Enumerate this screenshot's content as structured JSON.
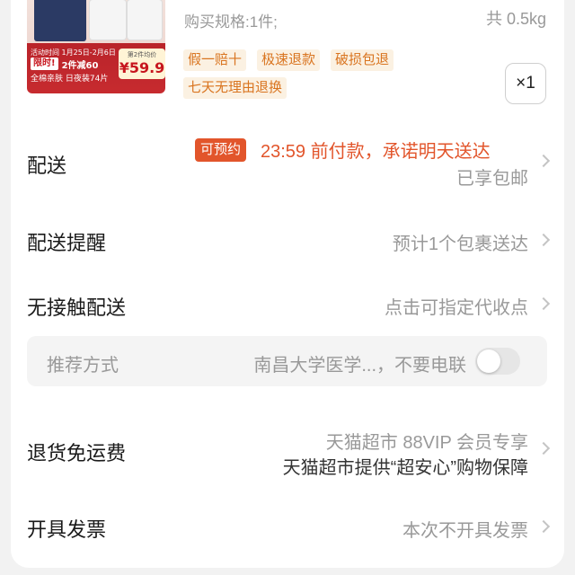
{
  "product": {
    "thumb": {
      "top_text": "活动时间 1月25日-2月6日",
      "promo_chip": "限时!",
      "promo_text": "2件减60",
      "bottom_text": "全棉亲肤 日夜装74片",
      "price_small": "第2件均价",
      "price": "¥59.9"
    },
    "spec": "购买规格:1件;",
    "weight": "共 0.5kg",
    "tags": [
      "假一赔十",
      "极速退款",
      "破损包退",
      "七天无理由退换"
    ],
    "quantity": "×1"
  },
  "delivery": {
    "label": "配送",
    "badge": "可预约",
    "promise": "23:59 前付款，承诺明天送达",
    "shipping": "已享包邮"
  },
  "delivery_reminder": {
    "label": "配送提醒",
    "value": "预计1个包裹送达"
  },
  "contactless": {
    "label": "无接触配送",
    "value": "点击可指定代收点"
  },
  "recommend": {
    "label": "推荐方式",
    "value": "南昌大学医学...，不要电联",
    "toggle_on": false
  },
  "return_shipping": {
    "label": "退货免运费",
    "line1": "天猫超市 88VIP 会员专享",
    "line2": "天猫超市提供“超安心”购物保障"
  },
  "invoice": {
    "label": "开具发票",
    "value": "本次不开具发票"
  },
  "colors": {
    "accent": "#e2552b",
    "tag_bg": "#fbf1e2",
    "tag_text": "#d9741f"
  }
}
